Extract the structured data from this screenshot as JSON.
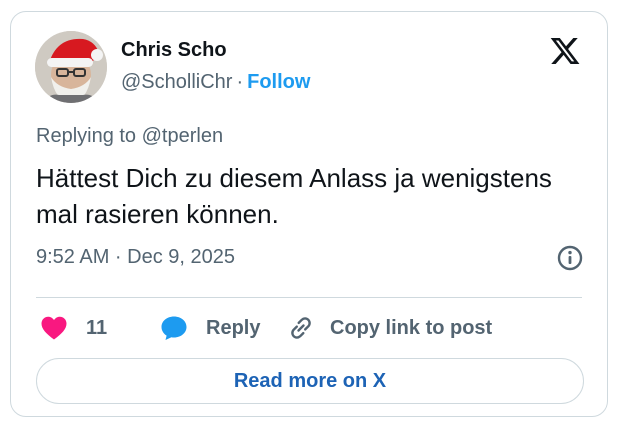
{
  "author": {
    "display_name": "Chris Scho",
    "handle": "@ScholliChr",
    "separator": "·",
    "follow_label": "Follow",
    "avatar_icon": "santa-hat-avatar"
  },
  "brand": {
    "logo_icon": "x-logo-icon",
    "text_color": "#0f1419",
    "link_color": "#1d9bf0",
    "like_color": "#f91880"
  },
  "tweet": {
    "replying_prefix": "Replying to",
    "replying_to": "@tperlen",
    "text": "Hättest Dich zu diesem Anlass ja wenigstens mal rasieren können.",
    "timestamp": "9:52 AM · Dec 9, 2025"
  },
  "actions": {
    "like_count": "11",
    "reply_label": "Reply",
    "copy_label": "Copy link to post"
  },
  "footer": {
    "read_more_label": "Read more on X"
  }
}
